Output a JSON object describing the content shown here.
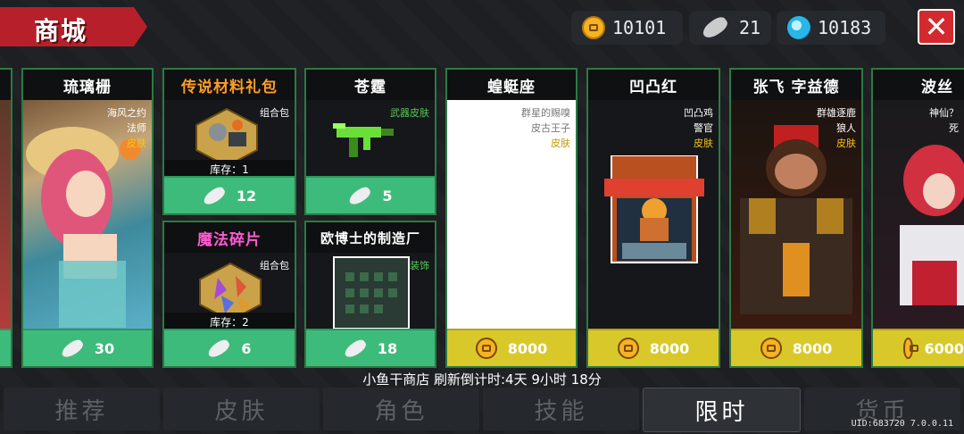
{
  "header": {
    "title": "商城",
    "gold": "10101",
    "fish": "21",
    "gems": "10183",
    "close_label": "✕"
  },
  "cards": {
    "c0": {
      "price": ""
    },
    "c1": {
      "title": "琉璃栅",
      "tags": [
        "海风之约",
        "法师",
        "皮肤"
      ],
      "price": "30"
    },
    "c2": {
      "title": "传说材料礼包",
      "tags": [
        "组合包"
      ],
      "stock": "库存：1",
      "price": "12"
    },
    "c3": {
      "title": "魔法碎片",
      "tags": [
        "组合包"
      ],
      "stock": "库存：2",
      "price": "6"
    },
    "c4": {
      "title": "苍霆",
      "tags": [
        "武器皮肤"
      ],
      "price": "5"
    },
    "c5": {
      "title": "欧博士的制造厂",
      "tags": [
        "装饰"
      ],
      "price": "18"
    },
    "c6": {
      "title": "蝗蜓座",
      "tags": [
        "群星的赐嗅",
        "皮古王子",
        "皮肤"
      ],
      "price": "8000"
    },
    "c7": {
      "title": "凹凸红",
      "tags": [
        "凹凸鸡",
        "警官",
        "皮肤"
      ],
      "price": "8000"
    },
    "c8": {
      "title": "张飞 字益德",
      "tags": [
        "群雄逐鹿",
        "狼人",
        "皮肤"
      ],
      "price": "8000"
    },
    "c9": {
      "title": "波丝",
      "tags": [
        "神仙？",
        "死"
      ],
      "price": "6000"
    }
  },
  "refresh_text": "小鱼干商店 刷新倒计时:4天 9小时 18分",
  "tabs": [
    "推荐",
    "皮肤",
    "角色",
    "技能",
    "限时",
    "货币"
  ],
  "active_tab": "限时",
  "uid_text": "UID:683720 7.0.0.11",
  "colors": {
    "accent_red": "#b7202a",
    "price_green": "#3dbb7a",
    "price_yellow": "#d9c82a",
    "card_border": "#2c7a43"
  }
}
